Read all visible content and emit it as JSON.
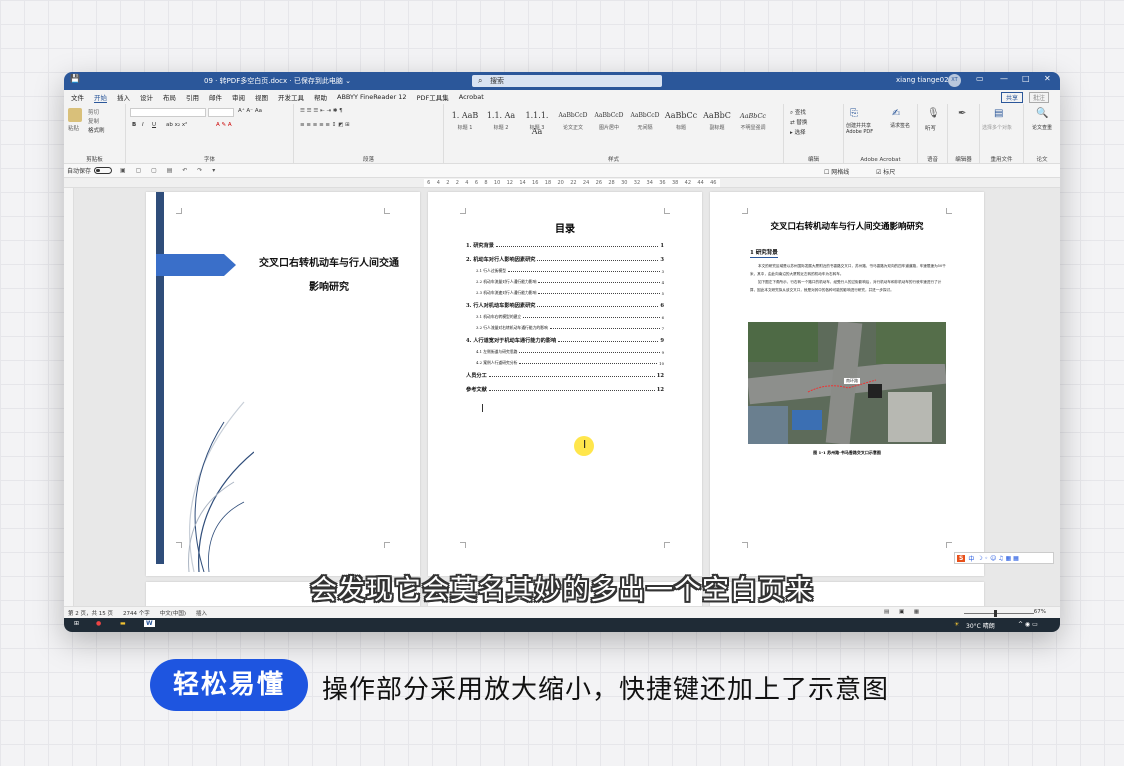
{
  "window": {
    "doc_title": "09 · 转PDF多空白页.docx · 已保存到此电脑 ⌄",
    "search_placeholder": "搜索",
    "user_name": "xiang tiange02",
    "user_initials": "XT",
    "share": "共享",
    "comment": "批注"
  },
  "menu": [
    "文件",
    "开始",
    "插入",
    "设计",
    "布局",
    "引用",
    "邮件",
    "审阅",
    "视图",
    "开发工具",
    "帮助",
    "ABBYY FineReader 12",
    "PDF工具集",
    "Acrobat"
  ],
  "ribbon": {
    "clipboard": {
      "label": "剪贴板",
      "paste": "粘贴",
      "cut": "剪切",
      "copy": "复制",
      "format_painter": "格式刷"
    },
    "font_label": "字体",
    "paragraph_label": "段落",
    "styles_label": "样式",
    "styles": [
      {
        "preview": "1. AaB",
        "name": "标题 1"
      },
      {
        "preview": "1.1. Aa",
        "name": "标题 2"
      },
      {
        "preview": "1.1.1. Aa",
        "name": "标题 3"
      },
      {
        "preview": "AaBbCcD",
        "name": "论文正文"
      },
      {
        "preview": "AaBbCcD",
        "name": "图片居中"
      },
      {
        "preview": "AaBbCcD",
        "name": "无间隔"
      },
      {
        "preview": "AaBbCc",
        "name": "标题"
      },
      {
        "preview": "AaBbC",
        "name": "副标题"
      },
      {
        "preview": "AaBbCc",
        "name": "不明显强调"
      }
    ],
    "editing": {
      "label": "编辑",
      "find": "查找",
      "replace": "替换",
      "select": "选择"
    },
    "acrobat": {
      "label": "Adobe Acrobat",
      "create_share": "创建并共享 Adobe PDF",
      "request_sign": "请求签名"
    },
    "voice": {
      "label": "语音",
      "dictate": "听写"
    },
    "editor": {
      "label": "编辑器",
      "name": "编辑器"
    },
    "reuse": {
      "label": "重用文件",
      "name": "重用文件"
    },
    "paper": {
      "label": "论文",
      "check": "论文查重"
    },
    "select_multi": "选择多个对象"
  },
  "qat": {
    "autosave": "自动保存",
    "gridlines": "网格线",
    "ruler": "标尺"
  },
  "ruler_ticks": [
    "6",
    "4",
    "2",
    "2",
    "4",
    "6",
    "8",
    "10",
    "12",
    "14",
    "16",
    "18",
    "20",
    "22",
    "24",
    "26",
    "28",
    "30",
    "32",
    "34",
    "36",
    "38",
    "42",
    "44",
    "46"
  ],
  "page1": {
    "title_line1": "交叉口右转机动车与行人间交通",
    "title_line2": "影响研究"
  },
  "page2": {
    "heading": "目录",
    "rows": [
      {
        "text": "1. 研究背景",
        "page": "1",
        "level": 1
      },
      {
        "text": "2. 机动车对行人影响因素研究",
        "page": "3",
        "level": 1
      },
      {
        "text": "2.1 行人过街模型",
        "page": "3",
        "level": 2
      },
      {
        "text": "2.2 机动车流量对行人通行能力影响",
        "page": "4",
        "level": 2
      },
      {
        "text": "2.3 机动车流速对行人通行能力影响",
        "page": "5",
        "level": 2
      },
      {
        "text": "3. 行人对机动车影响因素研究",
        "page": "6",
        "level": 1
      },
      {
        "text": "3.1 机动车右转模型的建立",
        "page": "6",
        "level": 2
      },
      {
        "text": "3.2 行人流量对右转机动车通行能力的影响",
        "page": "7",
        "level": 2
      },
      {
        "text": "4. 人行道宽对于机动车通行能力的影响",
        "page": "9",
        "level": 1
      },
      {
        "text": "4.1 左侧街道与研究思路",
        "page": "9",
        "level": 2
      },
      {
        "text": "4.2 案例人行道研究分析",
        "page": "10",
        "level": 2
      },
      {
        "text": "人员分工",
        "page": "12",
        "level": 1
      },
      {
        "text": "参考文献",
        "page": "12",
        "level": 1
      }
    ]
  },
  "page3": {
    "title": "交叉口右转机动车与行人间交通影响研究",
    "section": "1 研究背景",
    "body": [
      "本文的研究区域是以苏州国际发展大厦附近的书香路交叉口，苏州路、书马香路为双向的四车道道路，车速限速为50千米，其中，由此向南沿的大厦附近左转的机动车为右转车。",
      "如下图左下角所示，行右转一个路口的机动车，经受行人的过街影响后，对行机动车和非机动车的行驶车速进行了计算，因此本文研究拟从该交叉口，就是对其中的各种可能的影响进行研究，并进一步探讨。"
    ],
    "figure_caption": "图 1-1 苏州路-书马香路交叉口示意图",
    "map_label": "南环路"
  },
  "subtitle": "会发现它会莫名其妙的多出一个空白页来",
  "status": {
    "pages": "第 2 页，共 15 页",
    "words": "2744 个字",
    "lang": "中文(中国)",
    "insert": "插入",
    "zoom": "67%"
  },
  "taskbar": {
    "weather": "30°C 晴朗"
  },
  "ime": {
    "label": "中"
  },
  "badge": "轻松易懂",
  "caption": "操作部分采用放大缩小，快捷键还加上了示意图",
  "colors": {
    "word_blue": "#2b579a",
    "badge_blue": "#1e55e0",
    "cover_blue": "#3a6fc9"
  }
}
